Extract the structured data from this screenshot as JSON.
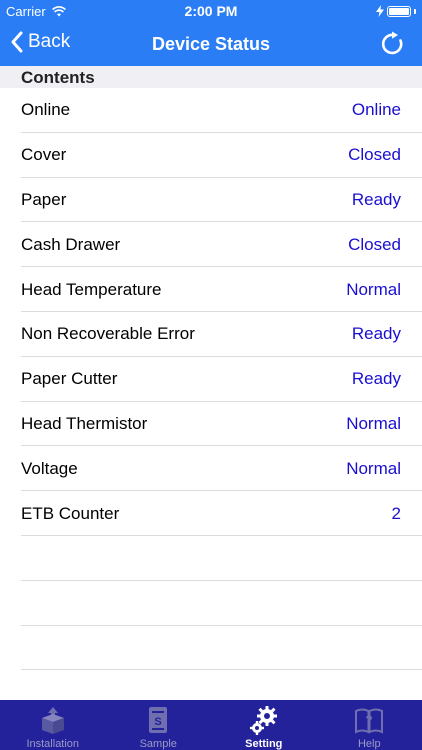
{
  "status_bar": {
    "carrier": "Carrier",
    "time": "2:00 PM"
  },
  "nav": {
    "back_label": "Back",
    "title": "Device Status",
    "refresh_icon": "refresh-icon"
  },
  "section": {
    "title": "Contents"
  },
  "rows": [
    {
      "label": "Online",
      "value": "Online"
    },
    {
      "label": "Cover",
      "value": "Closed"
    },
    {
      "label": "Paper",
      "value": "Ready"
    },
    {
      "label": "Cash Drawer",
      "value": "Closed"
    },
    {
      "label": "Head Temperature",
      "value": "Normal"
    },
    {
      "label": "Non Recoverable Error",
      "value": "Ready"
    },
    {
      "label": "Paper Cutter",
      "value": "Ready"
    },
    {
      "label": "Head Thermistor",
      "value": "Normal"
    },
    {
      "label": "Voltage",
      "value": "Normal"
    },
    {
      "label": "ETB Counter",
      "value": "2"
    }
  ],
  "tabs": [
    {
      "label": "Installation",
      "icon": "box-install-icon"
    },
    {
      "label": "Sample",
      "icon": "sample-document-icon"
    },
    {
      "label": "Setting",
      "icon": "gears-icon",
      "active": true
    },
    {
      "label": "Help",
      "icon": "help-book-icon"
    }
  ],
  "colors": {
    "nav": "#2a7df5",
    "value_text": "#1a0fd0",
    "tab_bar": "#23229a",
    "section_bg": "#efeff4"
  }
}
